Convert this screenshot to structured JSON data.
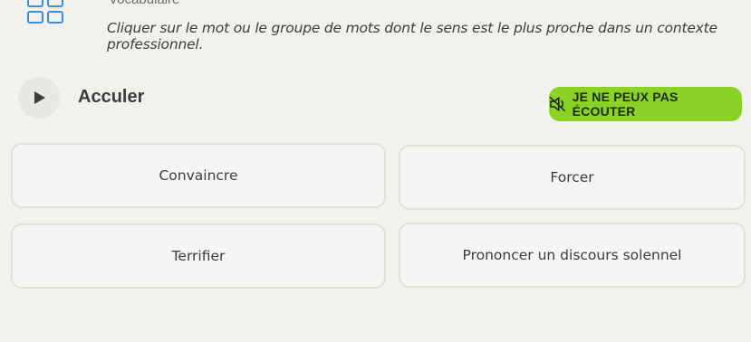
{
  "header": {
    "category": "Vocabulaire",
    "instruction": "Cliquer sur le mot ou le groupe de mots dont le sens est le plus proche dans un contexte professionnel."
  },
  "prompt": {
    "word": "Acculer",
    "play_icon": "play-icon"
  },
  "cant_listen": {
    "label": "JE NE PEUX PAS ÉCOUTER",
    "icon": "speaker-muted-icon"
  },
  "options": [
    {
      "label": "Convaincre"
    },
    {
      "label": "Forcer"
    },
    {
      "label": "Terrifier"
    },
    {
      "label": "Prononcer un discours solennel"
    }
  ],
  "colors": {
    "accent_green": "#8ad326",
    "icon_blue": "#3a8fd6",
    "background": "#f3f1ee"
  }
}
